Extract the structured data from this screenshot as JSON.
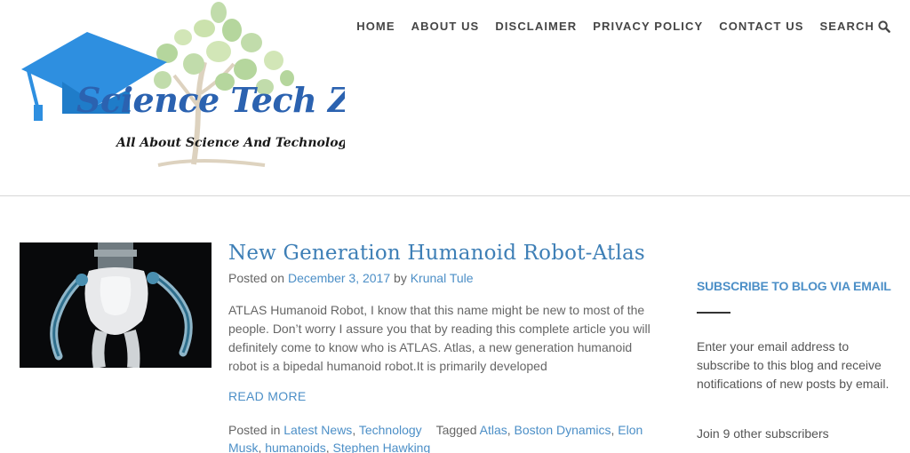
{
  "logo": {
    "title": "Science Tech Zone",
    "tagline": "All About Science And Technology"
  },
  "nav": {
    "items": [
      "HOME",
      "ABOUT US",
      "DISCLAIMER",
      "PRIVACY POLICY",
      "CONTACT US"
    ],
    "search_label": "SEARCH"
  },
  "post": {
    "title": "New Generation Humanoid Robot-Atlas",
    "posted_on_label": "Posted on",
    "date": "December 3, 2017",
    "by_label": "by",
    "author": "Krunal Tule",
    "excerpt": "ATLAS Humanoid Robot, I know that this name might be new to most of the people. Don’t worry I assure you that by reading this complete article you will definitely come to know who is ATLAS. Atlas, a new generation humanoid robot is a bipedal humanoid robot.It is primarily developed",
    "read_more": "READ MORE",
    "posted_in_label": "Posted in",
    "categories": [
      "Latest News",
      "Technology"
    ],
    "tagged_label": "Tagged",
    "tags": [
      "Atlas",
      "Boston Dynamics",
      "Elon Musk",
      "humanoids",
      "Stephen Hawking"
    ]
  },
  "sidebar": {
    "widget_title": "SUBSCRIBE TO BLOG VIA EMAIL",
    "description": "Enter your email address to subscribe to this blog and receive notifications of new posts by email.",
    "subscribers": "Join 9 other subscribers"
  },
  "colors": {
    "link": "#4c8fc7",
    "title": "#3e7fb6",
    "nav": "#454545",
    "logo_blue": "#2e8fe0",
    "logo_green": "#a9cf8c"
  }
}
